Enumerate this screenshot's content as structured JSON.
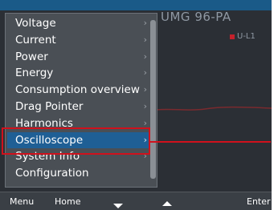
{
  "device": {
    "name": "UMG 96-PA"
  },
  "legend": {
    "label": "U-L1",
    "color": "#c4212b"
  },
  "menu": {
    "items": [
      {
        "label": "Voltage",
        "selected": false
      },
      {
        "label": "Current",
        "selected": false
      },
      {
        "label": "Power",
        "selected": false
      },
      {
        "label": "Energy",
        "selected": false
      },
      {
        "label": "Consumption overview",
        "selected": false
      },
      {
        "label": "Drag Pointer",
        "selected": false
      },
      {
        "label": "Harmonics",
        "selected": false
      },
      {
        "label": "Oscilloscope",
        "selected": true
      },
      {
        "label": "System Info",
        "selected": false
      },
      {
        "label": "Configuration",
        "selected": false
      }
    ],
    "chevron": "›"
  },
  "softkeys": {
    "menu": "Menu",
    "home": "Home",
    "down": "arrow-down-icon",
    "up": "arrow-up-icon",
    "enter": "Enter"
  },
  "colors": {
    "selected_bg": "#1f5f95",
    "highlight": "#d0111c"
  }
}
